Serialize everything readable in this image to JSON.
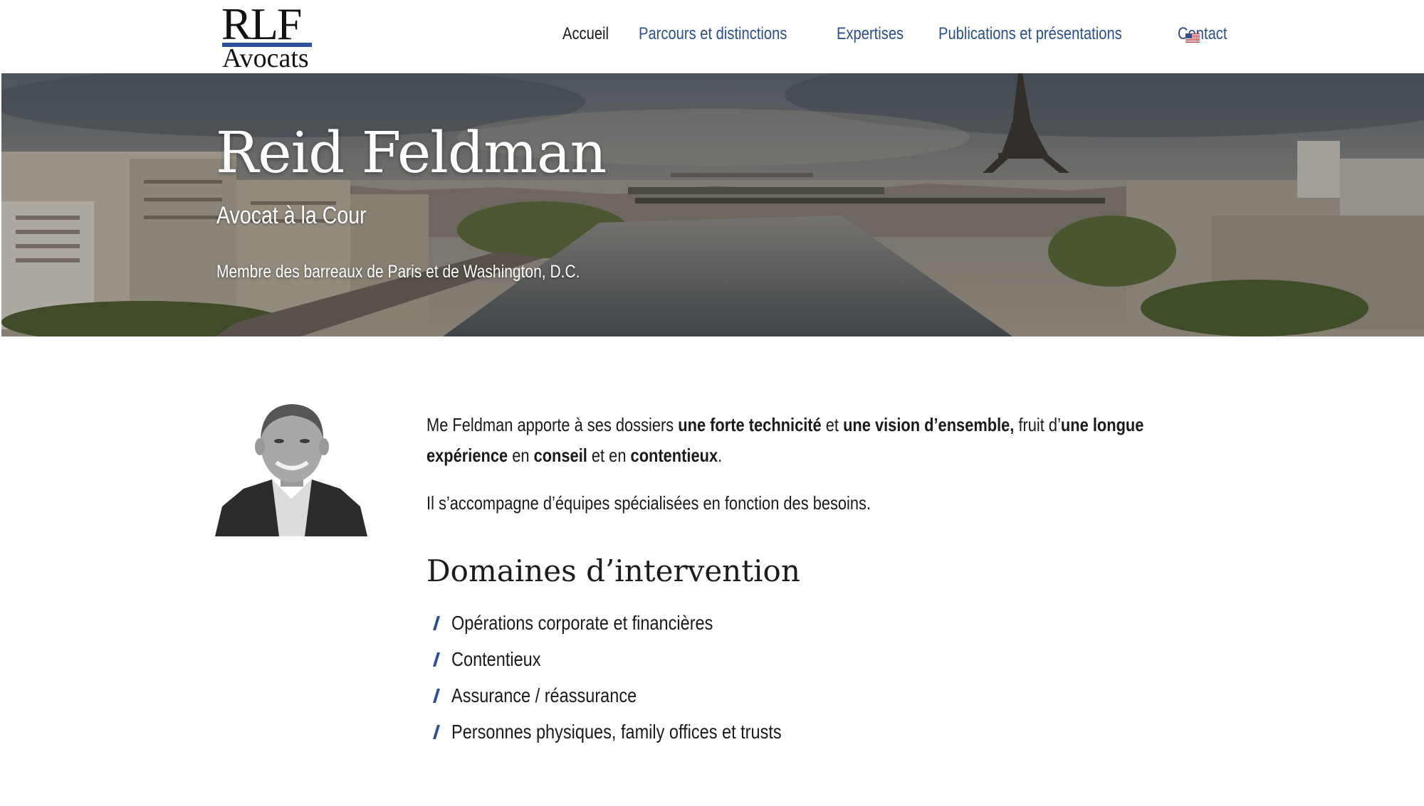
{
  "header": {
    "logo_top": "RLF",
    "logo_bottom": "Avocats",
    "nav": [
      {
        "label": "Accueil",
        "active": true
      },
      {
        "label": "Parcours et distinctions",
        "active": false
      },
      {
        "label": "Expertises",
        "active": false
      },
      {
        "label": "Publications et présentations",
        "active": false
      },
      {
        "label": "Contact",
        "active": false
      }
    ],
    "language_icon": "us-flag-icon"
  },
  "hero": {
    "title": "Reid Feldman",
    "subtitle": "Avocat à la Cour",
    "membership": "Membre des barreaux de Paris et de Washington, D.C."
  },
  "intro": {
    "p1_a": "Me Feldman apporte à ses dossiers ",
    "p1_b": "une forte technicité",
    "p1_c": " et ",
    "p1_d": "une vision d’ensemble,",
    "p1_e": " fruit d’",
    "p1_f": "une longue expérience",
    "p1_g": " en ",
    "p1_h": "conseil",
    "p1_i": " et en ",
    "p1_j": "contentieux",
    "p1_k": ".",
    "p2": "Il s’accompagne d’équipes spécialisées en fonction des besoins."
  },
  "domains": {
    "title": "Domaines d’intervention",
    "items": [
      "Opérations corporate et financières",
      "Contentieux",
      "Assurance / réassurance",
      "Personnes physiques, family offices et trusts"
    ]
  },
  "colors": {
    "accent_blue": "#2e4f99",
    "nav_blue": "#2c4f8f"
  }
}
